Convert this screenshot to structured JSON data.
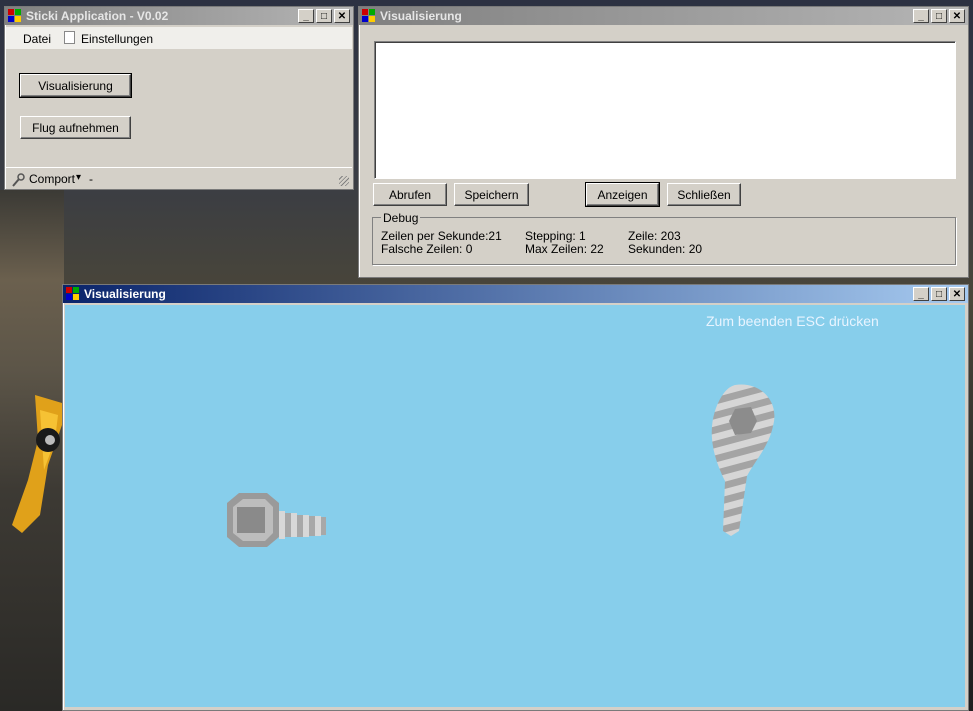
{
  "main_window": {
    "title": "Sticki Application - V0.02",
    "menu": [
      "Datei",
      "Einstellungen"
    ],
    "buttons": {
      "visualisierung": "Visualisierung",
      "flug": "Flug aufnehmen"
    },
    "status": {
      "comport": "Comport",
      "arrow": "▾",
      "value": "-"
    }
  },
  "vis_window": {
    "title": "Visualisierung",
    "buttons": {
      "abrufen": "Abrufen",
      "speichern": "Speichern",
      "anzeigen": "Anzeigen",
      "schliessen": "Schließen"
    },
    "debug": {
      "legend": "Debug",
      "zeilen_per_sekunde": "Zeilen per Sekunde:21",
      "falsche_zeilen": "Falsche Zeilen: 0",
      "stepping": "Stepping: 1",
      "max_zeilen": "Max Zeilen: 22",
      "zeile": "Zeile: 203",
      "sekunden": "Sekunden: 20"
    }
  },
  "render_window": {
    "title": "Visualisierung",
    "hint": "Zum beenden ESC drücken",
    "bg_color": "#87ceeb"
  },
  "window_controls": {
    "minimize": "_",
    "maximize": "□",
    "close": "✕"
  }
}
